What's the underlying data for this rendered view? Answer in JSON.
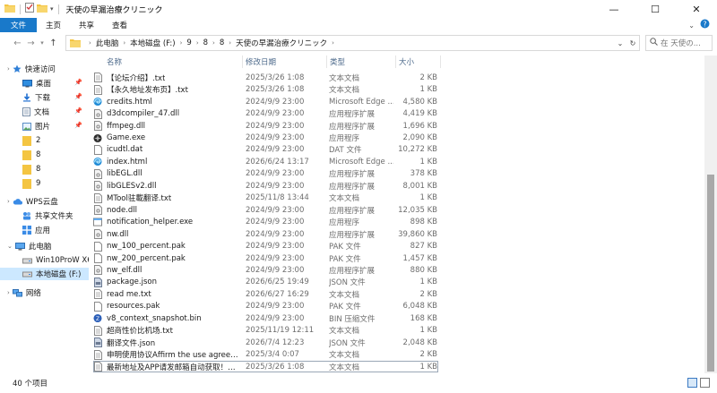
{
  "window": {
    "title": "天使の早漏治療クリニック",
    "minimize_glyph": "—",
    "maximize_glyph": "☐",
    "close_glyph": "✕"
  },
  "ribbon": {
    "tabs": [
      "文件",
      "主页",
      "共享",
      "查看"
    ]
  },
  "address": {
    "crumbs": [
      "此电脑",
      "本地磁盘 (F:)",
      "9",
      "8",
      "8",
      "天使の早漏治療クリニック"
    ],
    "search_placeholder": "在 天使の..."
  },
  "columns": {
    "name": "名称",
    "date": "修改日期",
    "type": "类型",
    "size": "大小"
  },
  "nav": [
    {
      "label": "快速访问",
      "icon": "star-icon",
      "pinned": false
    },
    {
      "label": "桌面",
      "icon": "desktop-icon",
      "pinned": true
    },
    {
      "label": "下载",
      "icon": "download-icon",
      "pinned": true
    },
    {
      "label": "文档",
      "icon": "documents-icon",
      "pinned": true
    },
    {
      "label": "图片",
      "icon": "pictures-icon",
      "pinned": true
    },
    {
      "label": "2",
      "icon": "folder-icon",
      "pinned": false
    },
    {
      "label": "8",
      "icon": "folder-icon",
      "pinned": false
    },
    {
      "label": "8",
      "icon": "folder-icon",
      "pinned": false
    },
    {
      "label": "9",
      "icon": "folder-icon",
      "pinned": false
    },
    {
      "label": "WPS云盘",
      "icon": "cloud-icon",
      "pinned": false
    },
    {
      "label": "共享文件夹",
      "icon": "shared-folder-icon",
      "pinned": false
    },
    {
      "label": "应用",
      "icon": "apps-icon",
      "pinned": false
    },
    {
      "label": "此电脑",
      "icon": "this-pc-icon",
      "pinned": false
    },
    {
      "label": "Win10ProW X64 (C",
      "icon": "drive-c-icon",
      "pinned": false
    },
    {
      "label": "本地磁盘 (F:)",
      "icon": "drive-icon",
      "pinned": false
    },
    {
      "label": "网络",
      "icon": "network-icon",
      "pinned": false
    }
  ],
  "files": [
    {
      "name": "【论坛介绍】.txt",
      "date": "2025/3/26 1:08",
      "type": "文本文档",
      "size": "2 KB",
      "icon": "txt"
    },
    {
      "name": "【永久地址发布页】.txt",
      "date": "2025/3/26 1:08",
      "type": "文本文档",
      "size": "1 KB",
      "icon": "txt"
    },
    {
      "name": "credits.html",
      "date": "2024/9/9 23:00",
      "type": "Microsoft Edge ...",
      "size": "4,580 KB",
      "icon": "edge"
    },
    {
      "name": "d3dcompiler_47.dll",
      "date": "2024/9/9 23:00",
      "type": "应用程序扩展",
      "size": "4,419 KB",
      "icon": "dll"
    },
    {
      "name": "ffmpeg.dll",
      "date": "2024/9/9 23:00",
      "type": "应用程序扩展",
      "size": "1,696 KB",
      "icon": "dll"
    },
    {
      "name": "Game.exe",
      "date": "2024/9/9 23:00",
      "type": "应用程序",
      "size": "2,090 KB",
      "icon": "exe"
    },
    {
      "name": "icudtl.dat",
      "date": "2024/9/9 23:00",
      "type": "DAT 文件",
      "size": "10,272 KB",
      "icon": "file"
    },
    {
      "name": "index.html",
      "date": "2026/6/24 13:17",
      "type": "Microsoft Edge ...",
      "size": "1 KB",
      "icon": "edge"
    },
    {
      "name": "libEGL.dll",
      "date": "2024/9/9 23:00",
      "type": "应用程序扩展",
      "size": "378 KB",
      "icon": "dll"
    },
    {
      "name": "libGLESv2.dll",
      "date": "2024/9/9 23:00",
      "type": "应用程序扩展",
      "size": "8,001 KB",
      "icon": "dll"
    },
    {
      "name": "MTool驻載翻译.txt",
      "date": "2025/11/8 13:44",
      "type": "文本文档",
      "size": "1 KB",
      "icon": "txt"
    },
    {
      "name": "node.dll",
      "date": "2024/9/9 23:00",
      "type": "应用程序扩展",
      "size": "12,035 KB",
      "icon": "dll"
    },
    {
      "name": "notification_helper.exe",
      "date": "2024/9/9 23:00",
      "type": "应用程序",
      "size": "898 KB",
      "icon": "app"
    },
    {
      "name": "nw.dll",
      "date": "2024/9/9 23:00",
      "type": "应用程序扩展",
      "size": "139,860 KB",
      "icon": "dll"
    },
    {
      "name": "nw_100_percent.pak",
      "date": "2024/9/9 23:00",
      "type": "PAK 文件",
      "size": "827 KB",
      "icon": "file"
    },
    {
      "name": "nw_200_percent.pak",
      "date": "2024/9/9 23:00",
      "type": "PAK 文件",
      "size": "1,457 KB",
      "icon": "file"
    },
    {
      "name": "nw_elf.dll",
      "date": "2024/9/9 23:00",
      "type": "应用程序扩展",
      "size": "880 KB",
      "icon": "dll"
    },
    {
      "name": "package.json",
      "date": "2026/6/25 19:49",
      "type": "JSON 文件",
      "size": "1 KB",
      "icon": "json"
    },
    {
      "name": "read me.txt",
      "date": "2026/6/27 16:29",
      "type": "文本文档",
      "size": "2 KB",
      "icon": "txt"
    },
    {
      "name": "resources.pak",
      "date": "2024/9/9 23:00",
      "type": "PAK 文件",
      "size": "6,048 KB",
      "icon": "file"
    },
    {
      "name": "v8_context_snapshot.bin",
      "date": "2024/9/9 23:00",
      "type": "BIN 压缩文件",
      "size": "168 KB",
      "icon": "bin"
    },
    {
      "name": "超商性价比机场.txt",
      "date": "2025/11/19 12:11",
      "type": "文本文档",
      "size": "1 KB",
      "icon": "txt"
    },
    {
      "name": "翻译文件.json",
      "date": "2026/7/4 12:23",
      "type": "JSON 文件",
      "size": "2,048 KB",
      "icon": "json"
    },
    {
      "name": "申明使用协议Affirm the use agreemen...",
      "date": "2025/3/4 0:07",
      "type": "文本文档",
      "size": "2 KB",
      "icon": "txt"
    },
    {
      "name": "最新地址及APP请发邮箱自动获取！！！...",
      "date": "2025/3/26 1:08",
      "type": "文本文档",
      "size": "1 KB",
      "icon": "txt"
    }
  ],
  "status": {
    "count": "40 个项目"
  },
  "colors": {
    "file_tab": "#1979ca",
    "selection": "#cce8ff",
    "header_text": "#4d6a8b",
    "folder": "#f4c542"
  }
}
